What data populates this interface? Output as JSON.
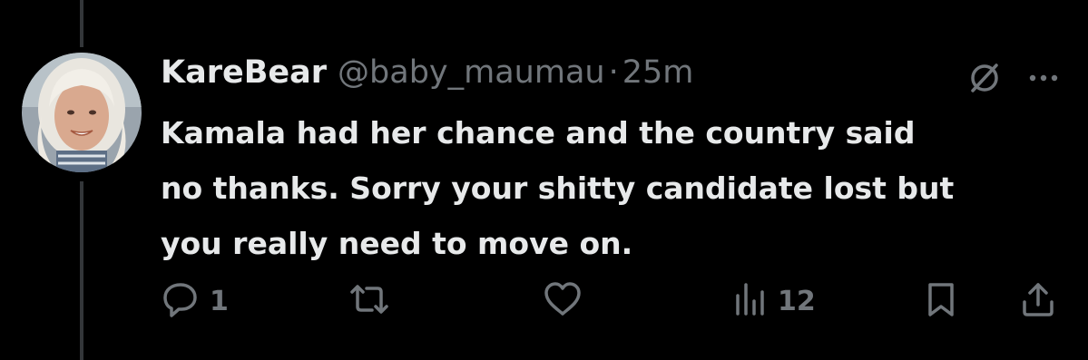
{
  "tweet": {
    "display_name": "KareBear",
    "handle": "@baby_maumau",
    "separator": "·",
    "time": "25m",
    "text": "Kamala had her chance and the country said\nno thanks. Sorry your shitty candidate lost but\nyou really need to move on."
  },
  "actions": {
    "reply_count": "1",
    "views_count": "12"
  },
  "icons": {
    "avatar": "profile-photo",
    "grok": "slashed-circle-icon",
    "more": "more-dots-icon",
    "reply": "reply-icon",
    "retweet": "retweet-icon",
    "like": "heart-icon",
    "views": "views-bars-icon",
    "bookmark": "bookmark-icon",
    "share": "share-icon"
  },
  "colors": {
    "background": "#000000",
    "primary_text": "#e7e9ea",
    "secondary_text": "#71767b",
    "thread_line": "#333639"
  }
}
